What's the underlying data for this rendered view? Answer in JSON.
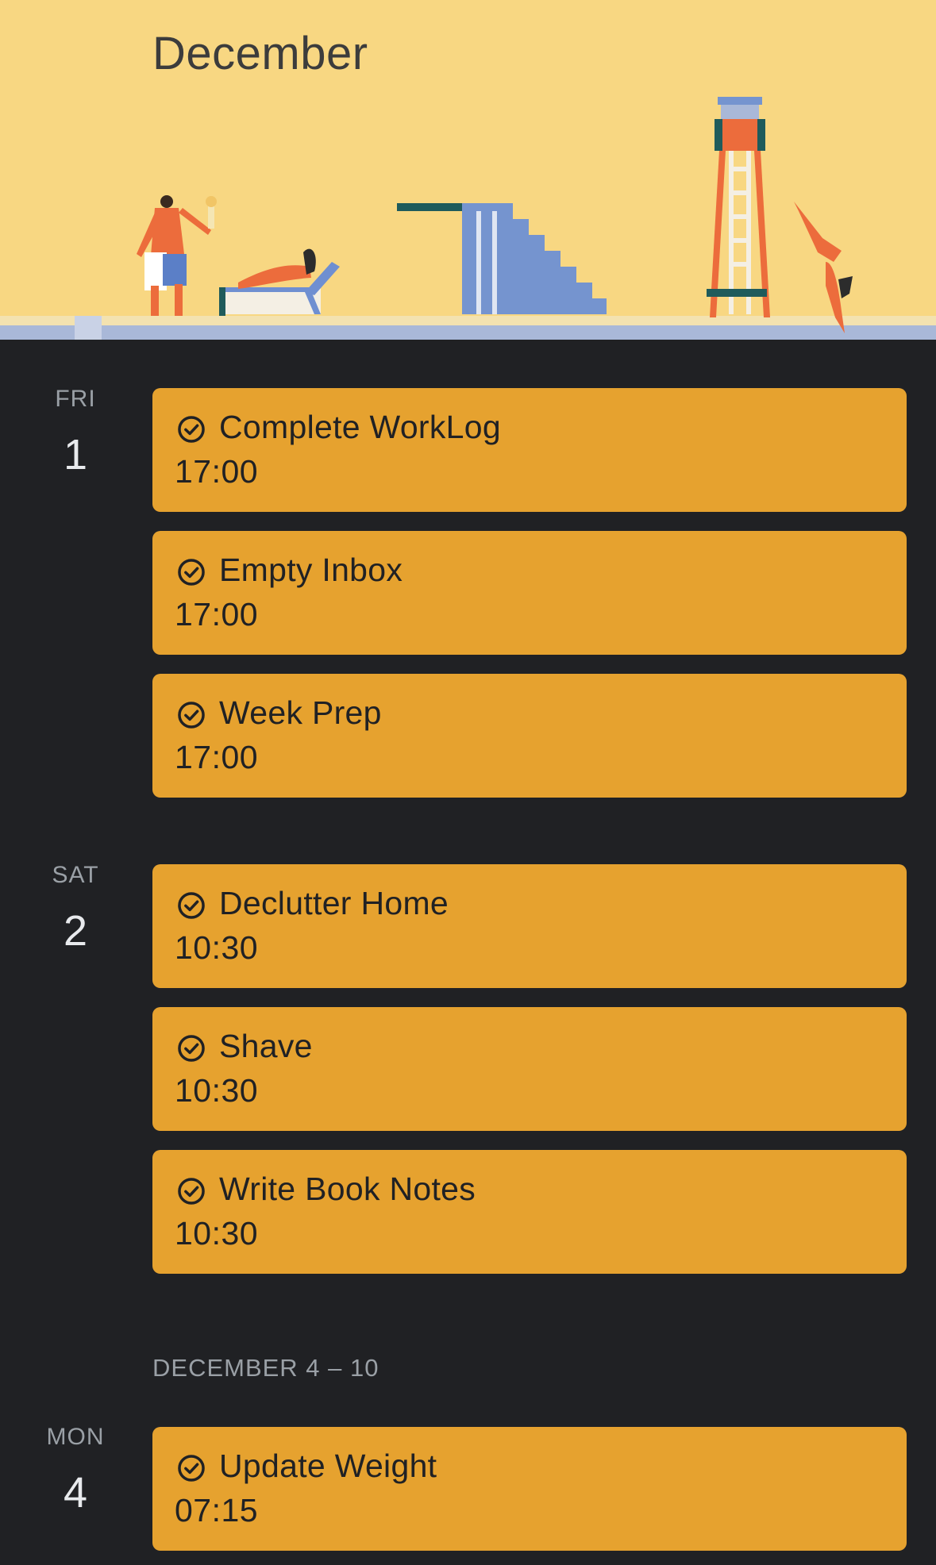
{
  "header": {
    "month": "December"
  },
  "days": [
    {
      "dow": "FRI",
      "day": "1",
      "events": [
        {
          "title": "Complete WorkLog",
          "time": "17:00"
        },
        {
          "title": "Empty Inbox",
          "time": "17:00"
        },
        {
          "title": "Week Prep",
          "time": "17:00"
        }
      ]
    },
    {
      "dow": "SAT",
      "day": "2",
      "events": [
        {
          "title": "Declutter Home",
          "time": "10:30"
        },
        {
          "title": "Shave",
          "time": "10:30"
        },
        {
          "title": "Write Book Notes",
          "time": "10:30"
        }
      ]
    },
    {
      "dow": "MON",
      "day": "4",
      "events": [
        {
          "title": "Update Weight",
          "time": "07:15"
        }
      ]
    }
  ],
  "week_range": "DECEMBER 4 – 10",
  "icons": {
    "event_icon": "task-check-icon"
  },
  "colors": {
    "background": "#202124",
    "banner": "#f8d782",
    "event": "#e6a22f",
    "event_text": "#202124",
    "day_label": "#9aa0a6",
    "day_number": "#e8eaed"
  }
}
